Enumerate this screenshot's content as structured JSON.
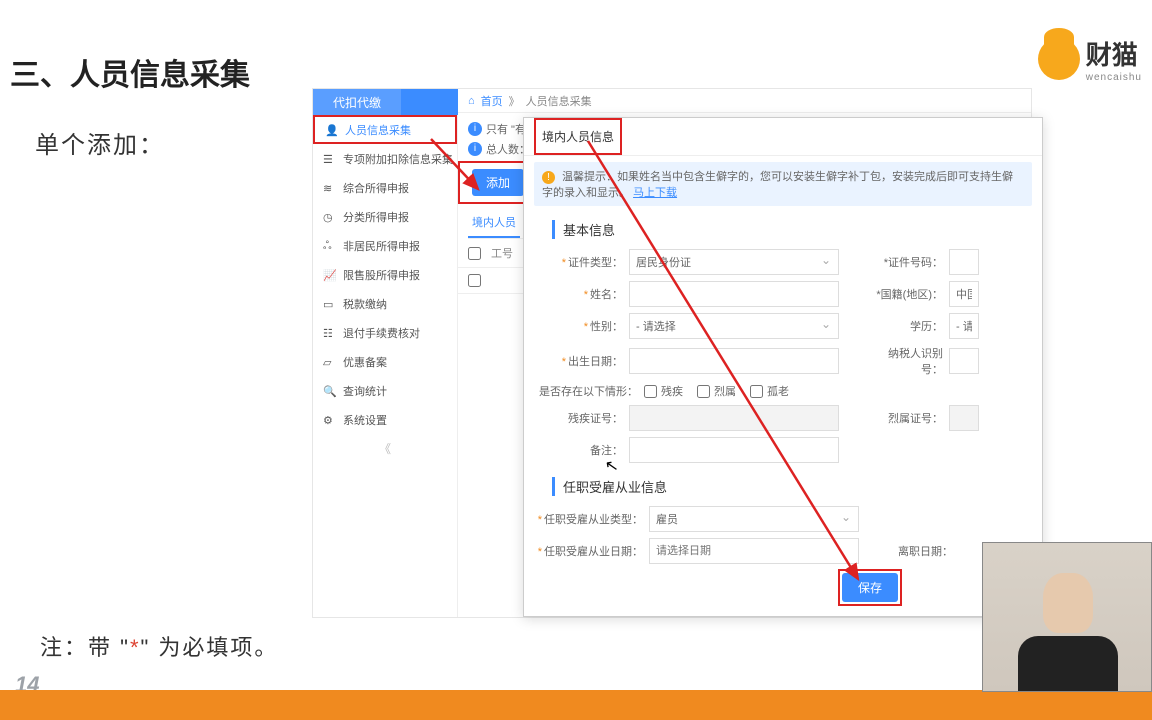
{
  "slide": {
    "title": "三、人员信息采集",
    "subtitle": "单个添加：",
    "note_pre": "注：带  \"",
    "note_star": "*",
    "note_post": "\"  为必填项。",
    "page_num": "14"
  },
  "brand": {
    "name": "财猫",
    "sub": "wencaishu"
  },
  "app": {
    "top_tab": "代扣代缴",
    "breadcrumb_home": "首页",
    "breadcrumb_sep": "》",
    "breadcrumb_current": "人员信息采集",
    "sidebar": [
      {
        "icon": "user",
        "label": "人员信息采集"
      },
      {
        "icon": "list",
        "label": "专项附加扣除信息采集"
      },
      {
        "icon": "layers",
        "label": "综合所得申报"
      },
      {
        "icon": "clock",
        "label": "分类所得申报"
      },
      {
        "icon": "person",
        "label": "非居民所得申报"
      },
      {
        "icon": "chart",
        "label": "限售股所得申报"
      },
      {
        "icon": "folder",
        "label": "税款缴纳"
      },
      {
        "icon": "doc",
        "label": "退付手续费核对"
      },
      {
        "icon": "card",
        "label": "优惠备案"
      },
      {
        "icon": "search",
        "label": "查询统计"
      },
      {
        "icon": "gear",
        "label": "系统设置"
      }
    ],
    "collapse": "《",
    "notice": "只有 \"有",
    "total_label": "总人数：",
    "add_btn": "添加",
    "tab_domestic": "境内人员",
    "col_id": "工号"
  },
  "modal": {
    "tab_title": "境内人员信息",
    "tip_label": "温馨提示：",
    "tip_text": "如果姓名当中包含生僻字的，您可以安装生僻字补丁包，安装完成后即可支持生僻字的录入和显示。",
    "tip_link": "马上下载",
    "section_basic": "基本信息",
    "f_idtype": "证件类型：",
    "v_idtype": "居民身份证",
    "f_idno": "证件号码：",
    "f_name": "姓名：",
    "f_nation": "国籍(地区)：",
    "v_nation": "中国",
    "f_gender": "性别：",
    "v_gender": "- 请选择",
    "f_edu": "学历：",
    "v_edu": "- 请选",
    "f_birth": "出生日期：",
    "f_taxid": "纳税人识别号：",
    "f_exist": "是否存在以下情形：",
    "chk_disabled": "残疾",
    "chk_martyr": "烈属",
    "chk_elder": "孤老",
    "f_disno": "残疾证号：",
    "f_marno": "烈属证号：",
    "f_remark": "备注：",
    "section_job": "任职受雇从业信息",
    "f_jobtype": "任职受雇从业类型：",
    "v_jobtype": "雇员",
    "f_jobdate": "任职受雇从业日期：",
    "v_jobdate": "请选择日期",
    "f_leavedate": "离职日期：",
    "save_btn": "保存"
  }
}
